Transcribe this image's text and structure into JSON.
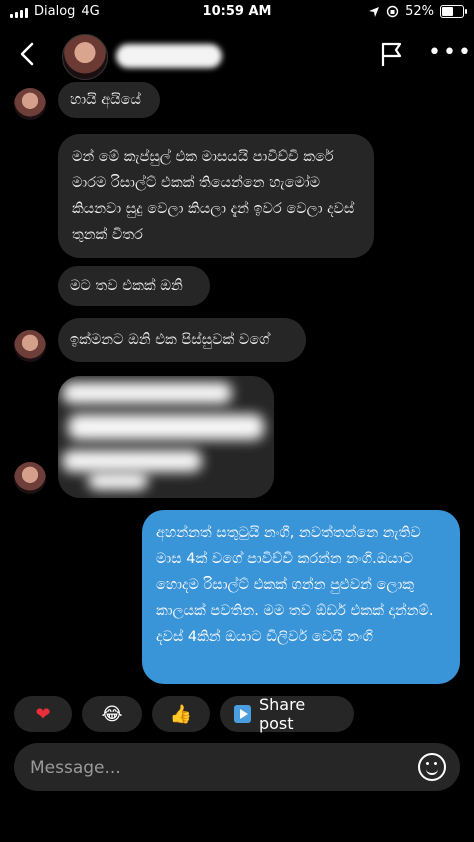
{
  "status": {
    "carrier": "Dialog",
    "network": "4G",
    "time": "10:59 AM",
    "battery": "52%",
    "battery_level": 0.52
  },
  "header": {
    "back_icon": "chevron-left-icon",
    "flag_icon": "flag-icon",
    "more_icon": "more-horizontal-icon",
    "more_glyph": "•••"
  },
  "messages": [
    {
      "text": "හායි අයියේ"
    },
    {
      "text": "මන් මේ කැප්සුල් එක මාසයයි පාවිච්චි කරේ මාරම රිසාල්ට් එකක් තියෙන්නෙ හැමෝම කියනවා සුදු වෙලා කියලා දැන් ඉවර වෙලා දවස් තුනක් විතර"
    },
    {
      "text": "මට තව එකක් ඔනි"
    },
    {
      "text": "ඉක්මනට ඔනි එක පිස්සුවක් වගේ"
    },
    {
      "text": "අහන්නත් සතුටුයි නංගී, නවත්තන්නෙ නැතිව මාස 4ක් වගේ පාවිච්චි කරන්න නංගි.ඔයාට හොදම රිසාල්ට් එකක් ගන්න පුළුවන් ලොකු කාලයක් පවතින. මම තව ඕඩර් එකක් දාන්නම්. දවස් 4කින් ඔයාට ඩිලිවර් වෙයි නංගි"
    }
  ],
  "reactions": {
    "heart": "❤",
    "laugh": "😂",
    "thumbs": "👍",
    "share_label": "Share post"
  },
  "composer": {
    "placeholder": "Message..."
  }
}
